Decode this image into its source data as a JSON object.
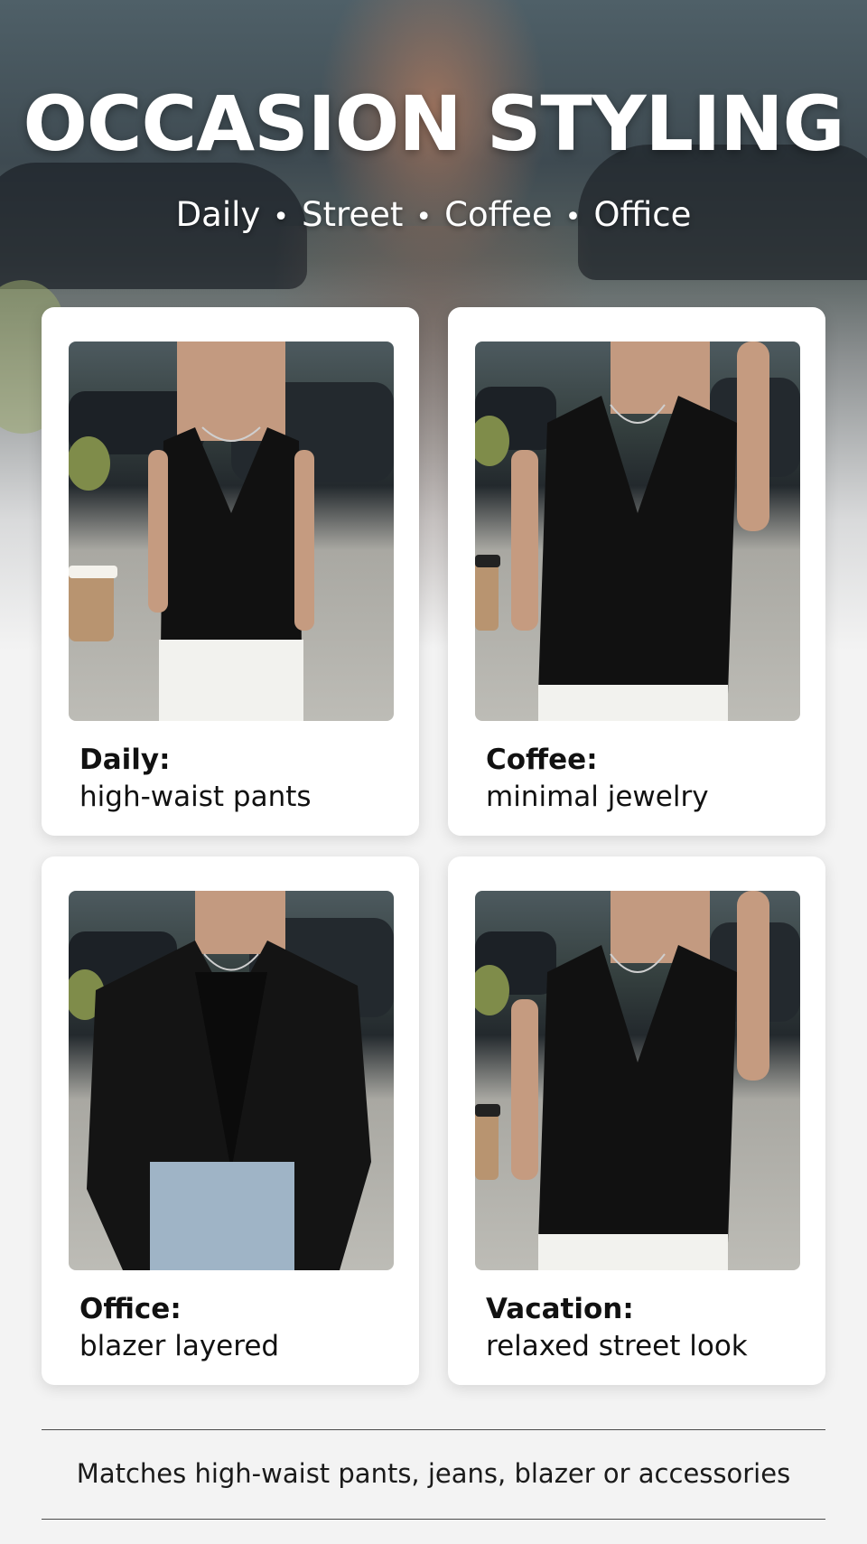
{
  "header": {
    "title": "OCCASION STYLING",
    "subtitle_items": [
      "Daily",
      "Street",
      "Coffee",
      "Office"
    ],
    "separator": "•"
  },
  "cards": [
    {
      "title": "Daily:",
      "text": "high-waist pants",
      "outfit": "halter vest with white pants and coffee cup"
    },
    {
      "title": "Coffee:",
      "text": "minimal jewelry",
      "outfit": "halter vest with necklace and coffee cup"
    },
    {
      "title": "Office:",
      "text": "blazer layered",
      "outfit": "vest under black blazer with denim jeans"
    },
    {
      "title": "Vacation:",
      "text": "relaxed street look",
      "outfit": "halter vest with white pants and coffee cup"
    }
  ],
  "footer": {
    "text": "Matches high-waist pants, jeans, blazer or accessories"
  },
  "colors": {
    "card_background": "#ffffff",
    "page_background": "#f3f3f3",
    "vest": "#111111",
    "pants_white": "#f2f2ee",
    "denim": "#9fb4c6"
  }
}
